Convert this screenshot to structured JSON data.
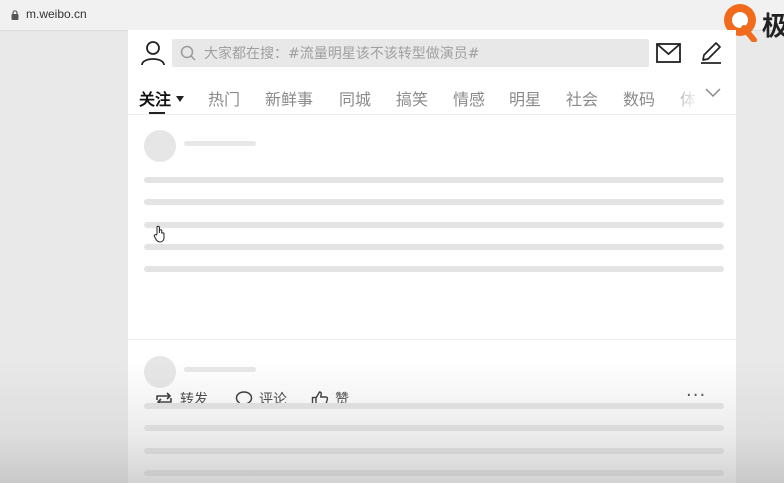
{
  "browser": {
    "url": "m.weibo.cn"
  },
  "overlay": {
    "brand_text": "极"
  },
  "header": {
    "search_placeholder": "大家都在搜：#流量明星该不该转型做演员#"
  },
  "tabs": [
    {
      "label": "关注",
      "active": true
    },
    {
      "label": "热门",
      "active": false
    },
    {
      "label": "新鲜事",
      "active": false
    },
    {
      "label": "同城",
      "active": false
    },
    {
      "label": "搞笑",
      "active": false
    },
    {
      "label": "情感",
      "active": false
    },
    {
      "label": "明星",
      "active": false
    },
    {
      "label": "社会",
      "active": false
    },
    {
      "label": "数码",
      "active": false
    },
    {
      "label": "体",
      "active": false
    }
  ],
  "post_actions": {
    "repost": "转发",
    "comment": "评论",
    "like": "赞",
    "more": "···"
  },
  "icons": {
    "profile": "user-icon",
    "message": "mail-icon",
    "compose": "pencil-icon",
    "search": "search-icon",
    "expand": "chevron-down-icon"
  },
  "colors": {
    "skeleton": "#e4e4e4",
    "brand_orange": "#f26a1b"
  }
}
